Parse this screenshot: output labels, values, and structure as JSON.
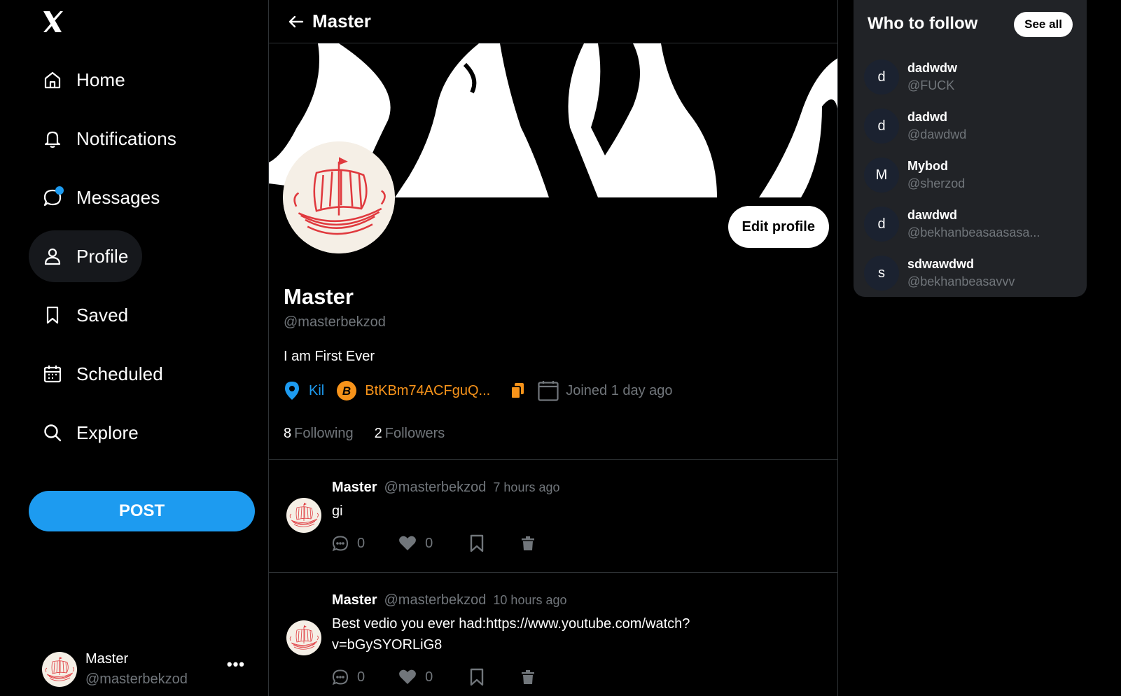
{
  "sidebar": {
    "logo": "x-logo",
    "items": [
      {
        "label": "Home",
        "icon": "home-icon"
      },
      {
        "label": "Notifications",
        "icon": "bell-icon"
      },
      {
        "label": "Messages",
        "icon": "message-icon"
      },
      {
        "label": "Profile",
        "icon": "user-icon"
      },
      {
        "label": "Saved",
        "icon": "bookmark-icon"
      },
      {
        "label": "Scheduled",
        "icon": "calendar-icon"
      },
      {
        "label": "Explore",
        "icon": "search-icon"
      }
    ],
    "post_label": "POST",
    "account": {
      "name": "Master",
      "handle": "@masterbekzod",
      "more": "•••"
    }
  },
  "header": {
    "title": "Master"
  },
  "profile": {
    "name": "Master",
    "handle": "@masterbekzod",
    "bio": "I am First Ever",
    "location": "Kil",
    "btc": "BtKBm74ACFguQ...",
    "joined": "Joined 1 day ago",
    "edit_label": "Edit profile",
    "following_count": "8",
    "following_label": "Following",
    "followers_count": "2",
    "followers_label": "Followers"
  },
  "posts": [
    {
      "author": "Master",
      "handle": "@masterbekzod",
      "time": "7 hours ago",
      "text": "gi",
      "replies": "0",
      "likes": "0"
    },
    {
      "author": "Master",
      "handle": "@masterbekzod",
      "time": "10 hours ago",
      "text_line1": "Best vedio you ever had:https://www.youtube.com/watch?",
      "text_line2": "v=bGySYORLiG8",
      "replies": "0",
      "likes": "0"
    }
  ],
  "who_to_follow": {
    "title": "Who to follow",
    "see_all": "See all",
    "users": [
      {
        "initial": "d",
        "name": "dadwdw",
        "handle": "@FUCK"
      },
      {
        "initial": "d",
        "name": "dadwd",
        "handle": "@dawdwd"
      },
      {
        "initial": "M",
        "name": "Mybod",
        "handle": "@sherzod"
      },
      {
        "initial": "d",
        "name": "dawdwd",
        "handle": "@bekhanbeasaasasa..."
      },
      {
        "initial": "s",
        "name": "sdwawdwd",
        "handle": "@bekhanbeasavvv"
      }
    ]
  },
  "colors": {
    "accent": "#1d9bf0",
    "bitcoin": "#f7931a",
    "muted": "#71767b",
    "background": "#000000",
    "panel": "#212327"
  }
}
